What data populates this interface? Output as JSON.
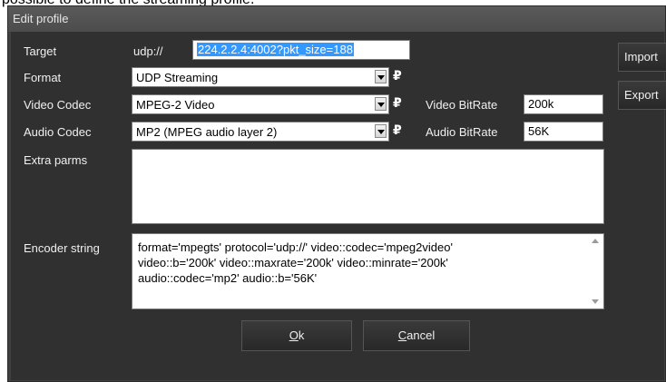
{
  "caption": "possible to define the streaming profile.",
  "window": {
    "title": "Edit profile"
  },
  "labels": {
    "target": "Target",
    "format": "Format",
    "video_codec": "Video Codec",
    "audio_codec": "Audio Codec",
    "extra_parms": "Extra parms",
    "encoder_string": "Encoder string",
    "video_bitrate": "Video BitRate",
    "audio_bitrate": "Audio BitRate"
  },
  "fields": {
    "target_prefix": "udp://",
    "target_value": "224.2.2.4:4002?pkt_size=188",
    "format": "UDP Streaming",
    "video_codec": "MPEG-2 Video",
    "audio_codec": "MP2 (MPEG audio layer 2)",
    "video_bitrate": "200k",
    "audio_bitrate": "56K",
    "extra_parms": "",
    "encoder_string_lines": [
      "format='mpegts' protocol='udp://' video::codec='mpeg2video'",
      "video::b='200k' video::maxrate='200k' video::minrate='200k'",
      "audio::codec='mp2' audio::b='56K'"
    ]
  },
  "buttons": {
    "ok_mnemonic": "O",
    "ok_rest": "k",
    "cancel_mnemonic": "C",
    "cancel_rest": "ancel",
    "import": "Import",
    "export": "Export"
  },
  "colors": {
    "window_bg": "#404040",
    "client_bg": "#303030",
    "selection": "#3399ff"
  }
}
